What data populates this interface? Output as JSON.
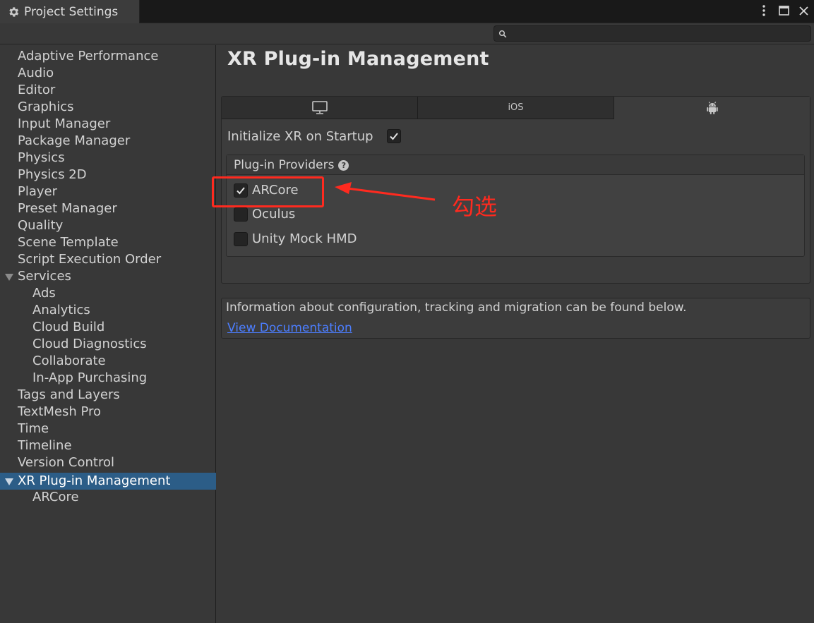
{
  "window": {
    "tab_title": "Project Settings",
    "tab_icon": "gear-icon"
  },
  "search": {
    "placeholder": ""
  },
  "sidebar": {
    "items": [
      {
        "label": "Adaptive Performance"
      },
      {
        "label": "Audio"
      },
      {
        "label": "Editor"
      },
      {
        "label": "Graphics"
      },
      {
        "label": "Input Manager"
      },
      {
        "label": "Package Manager"
      },
      {
        "label": "Physics"
      },
      {
        "label": "Physics 2D"
      },
      {
        "label": "Player"
      },
      {
        "label": "Preset Manager"
      },
      {
        "label": "Quality"
      },
      {
        "label": "Scene Template"
      },
      {
        "label": "Script Execution Order"
      },
      {
        "label": "Services",
        "expandable": true
      },
      {
        "label": "Ads",
        "child": true
      },
      {
        "label": "Analytics",
        "child": true
      },
      {
        "label": "Cloud Build",
        "child": true
      },
      {
        "label": "Cloud Diagnostics",
        "child": true
      },
      {
        "label": "Collaborate",
        "child": true
      },
      {
        "label": "In-App Purchasing",
        "child": true
      },
      {
        "label": "Tags and Layers"
      },
      {
        "label": "TextMesh Pro"
      },
      {
        "label": "Time"
      },
      {
        "label": "Timeline"
      },
      {
        "label": "Version Control"
      },
      {
        "label": "XR Plug-in Management",
        "expandable": true,
        "selected": true
      },
      {
        "label": "ARCore",
        "child": true
      }
    ],
    "selected_color": "#2c5d87"
  },
  "main": {
    "title": "XR Plug-in Management",
    "platform_tabs": [
      {
        "icon": "monitor-icon",
        "label": ""
      },
      {
        "icon": "",
        "label": "iOS"
      },
      {
        "icon": "android-icon",
        "label": "",
        "active": true
      }
    ],
    "init_xr_label": "Initialize XR on Startup",
    "init_xr_checked": true,
    "providers_header": "Plug-in Providers",
    "providers": [
      {
        "label": "ARCore",
        "checked": true
      },
      {
        "label": "Oculus",
        "checked": false
      },
      {
        "label": "Unity Mock HMD",
        "checked": false
      }
    ],
    "info_text": "Information about configuration, tracking and migration can be found below.",
    "doc_link": "View Documentation",
    "link_color": "#4c7eff"
  },
  "annotation": {
    "text": "勾选",
    "color": "#ff2a1f"
  }
}
